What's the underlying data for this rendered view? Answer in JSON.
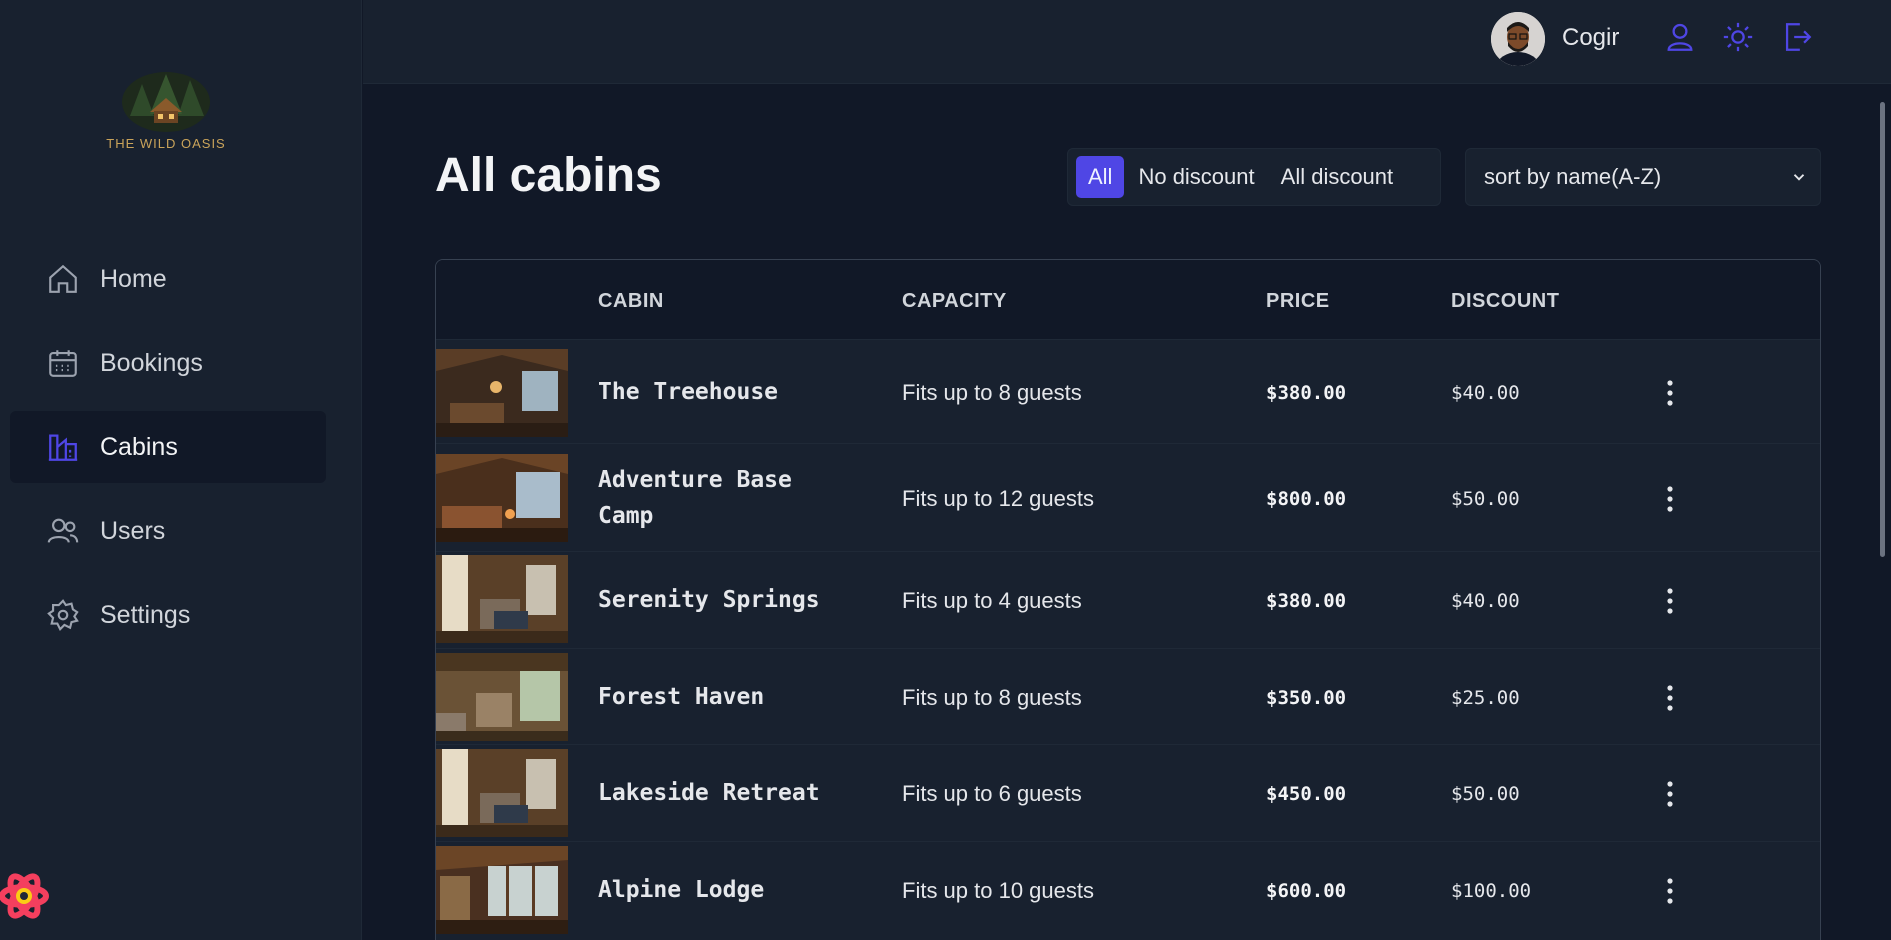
{
  "brand": {
    "name": "THE WILD OASIS"
  },
  "sidebar": {
    "items": [
      {
        "label": "Home",
        "icon": "home-icon"
      },
      {
        "label": "Bookings",
        "icon": "calendar-icon"
      },
      {
        "label": "Cabins",
        "icon": "cabin-icon",
        "active": true
      },
      {
        "label": "Users",
        "icon": "users-icon"
      },
      {
        "label": "Settings",
        "icon": "gear-icon"
      }
    ]
  },
  "header": {
    "user_name": "Cogir",
    "icons": [
      "user-icon",
      "sun-icon",
      "logout-icon"
    ]
  },
  "main": {
    "title": "All cabins",
    "filter": {
      "options": [
        "All",
        "No discount",
        "All discount"
      ],
      "selected": "All"
    },
    "sort": {
      "selected": "sort by name(A-Z)"
    },
    "table": {
      "headers": [
        "CABIN",
        "CAPACITY",
        "PRICE",
        "DISCOUNT"
      ],
      "rows": [
        {
          "name": "The Treehouse",
          "capacity": "Fits up to 8 guests",
          "price": "$380.00",
          "discount": "$40.00"
        },
        {
          "name": "Adventure Base Camp",
          "capacity": "Fits up to 12 guests",
          "price": "$800.00",
          "discount": "$50.00"
        },
        {
          "name": "Serenity Springs",
          "capacity": "Fits up to 4 guests",
          "price": "$380.00",
          "discount": "$40.00"
        },
        {
          "name": "Forest Haven",
          "capacity": "Fits up to 8 guests",
          "price": "$350.00",
          "discount": "$25.00"
        },
        {
          "name": "Lakeside Retreat",
          "capacity": "Fits up to 6 guests",
          "price": "$450.00",
          "discount": "$50.00"
        },
        {
          "name": "Alpine Lodge",
          "capacity": "Fits up to 10 guests",
          "price": "$600.00",
          "discount": "$100.00"
        }
      ]
    }
  },
  "colors": {
    "accent": "#4f46e5",
    "background": "#111827",
    "panel": "#18212f",
    "brand_gold": "#c9a35a"
  }
}
